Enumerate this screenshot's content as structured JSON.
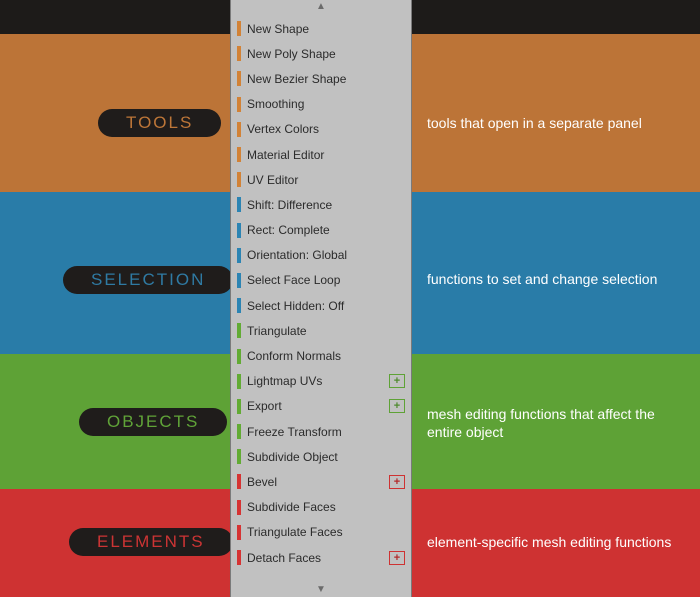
{
  "sections": {
    "tools": {
      "label": "TOOLS",
      "description": "tools that open in a separate panel",
      "color": "#bc7437"
    },
    "selection": {
      "label": "SELECTION",
      "description": "functions to set and change selection",
      "color": "#297ca8"
    },
    "objects": {
      "label": "OBJECTS",
      "description": "mesh editing functions that affect the entire object",
      "color": "#5ea236"
    },
    "elements": {
      "label": "ELEMENTS",
      "description": "element-specific mesh editing functions",
      "color": "#ce3232"
    }
  },
  "scroll": {
    "up": "▲",
    "down": "▼"
  },
  "plus_glyph": "+",
  "menu": [
    {
      "label": "New Shape",
      "group": "tools",
      "plus": false
    },
    {
      "label": "New Poly Shape",
      "group": "tools",
      "plus": false
    },
    {
      "label": "New Bezier Shape",
      "group": "tools",
      "plus": false
    },
    {
      "label": "Smoothing",
      "group": "tools",
      "plus": false
    },
    {
      "label": "Vertex Colors",
      "group": "tools",
      "plus": false
    },
    {
      "label": "Material Editor",
      "group": "tools",
      "plus": false
    },
    {
      "label": "UV Editor",
      "group": "tools",
      "plus": false
    },
    {
      "label": "Shift: Difference",
      "group": "selection",
      "plus": false
    },
    {
      "label": "Rect: Complete",
      "group": "selection",
      "plus": false
    },
    {
      "label": "Orientation: Global",
      "group": "selection",
      "plus": false
    },
    {
      "label": "Select Face Loop",
      "group": "selection",
      "plus": false
    },
    {
      "label": "Select Hidden: Off",
      "group": "selection",
      "plus": false
    },
    {
      "label": "Triangulate",
      "group": "objects",
      "plus": false
    },
    {
      "label": "Conform Normals",
      "group": "objects",
      "plus": false
    },
    {
      "label": "Lightmap UVs",
      "group": "objects",
      "plus": true
    },
    {
      "label": "Export",
      "group": "objects",
      "plus": true
    },
    {
      "label": "Freeze Transform",
      "group": "objects",
      "plus": false
    },
    {
      "label": "Subdivide Object",
      "group": "objects",
      "plus": false
    },
    {
      "label": "Bevel",
      "group": "elements",
      "plus": true
    },
    {
      "label": "Subdivide Faces",
      "group": "elements",
      "plus": false
    },
    {
      "label": "Triangulate Faces",
      "group": "elements",
      "plus": false
    },
    {
      "label": "Detach Faces",
      "group": "elements",
      "plus": true
    }
  ]
}
